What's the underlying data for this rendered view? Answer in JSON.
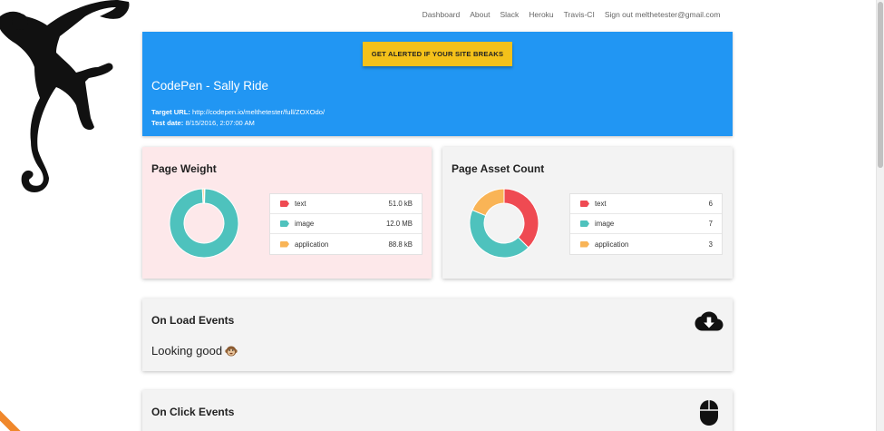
{
  "nav": {
    "items": [
      "Dashboard",
      "About",
      "Slack",
      "Heroku",
      "Travis-CI",
      "Sign out melthetester@gmail.com"
    ]
  },
  "hero": {
    "button_label": "GET ALERTED IF YOUR SITE BREAKS",
    "title": "CodePen - Sally Ride",
    "target_label": "Target URL:",
    "target_url": "http://codepen.io/melthetester/full/ZOXOdo/",
    "date_label": "Test date:",
    "date_value": "8/15/2016, 2:07:00 AM",
    "color": "#2196f3",
    "button_color": "#f4c11a"
  },
  "page_weight": {
    "title": "Page Weight",
    "rows": [
      {
        "label": "text",
        "value": "51.0 kB",
        "color": "#ef4a52"
      },
      {
        "label": "image",
        "value": "12.0 MB",
        "color": "#4ec2bd"
      },
      {
        "label": "application",
        "value": "88.8 kB",
        "color": "#f9b456"
      }
    ]
  },
  "asset_count": {
    "title": "Page Asset Count",
    "rows": [
      {
        "label": "text",
        "value": "6",
        "color": "#ef4a52"
      },
      {
        "label": "image",
        "value": "7",
        "color": "#4ec2bd"
      },
      {
        "label": "application",
        "value": "3",
        "color": "#f9b456"
      }
    ]
  },
  "load_events": {
    "title": "On Load Events",
    "status": "Looking good",
    "icon": "cloud-download-icon"
  },
  "click_events": {
    "title": "On Click Events",
    "icon": "mouse-icon"
  },
  "chart_data": [
    {
      "type": "pie",
      "title": "Page Weight",
      "categories": [
        "text",
        "image",
        "application"
      ],
      "values": [
        51.0,
        12000.0,
        88.8
      ],
      "unit": "kB",
      "colors": [
        "#ef4a52",
        "#4ec2bd",
        "#f9b456"
      ]
    },
    {
      "type": "pie",
      "title": "Page Asset Count",
      "categories": [
        "text",
        "image",
        "application"
      ],
      "values": [
        6,
        7,
        3
      ],
      "colors": [
        "#ef4a52",
        "#4ec2bd",
        "#f9b456"
      ]
    }
  ]
}
